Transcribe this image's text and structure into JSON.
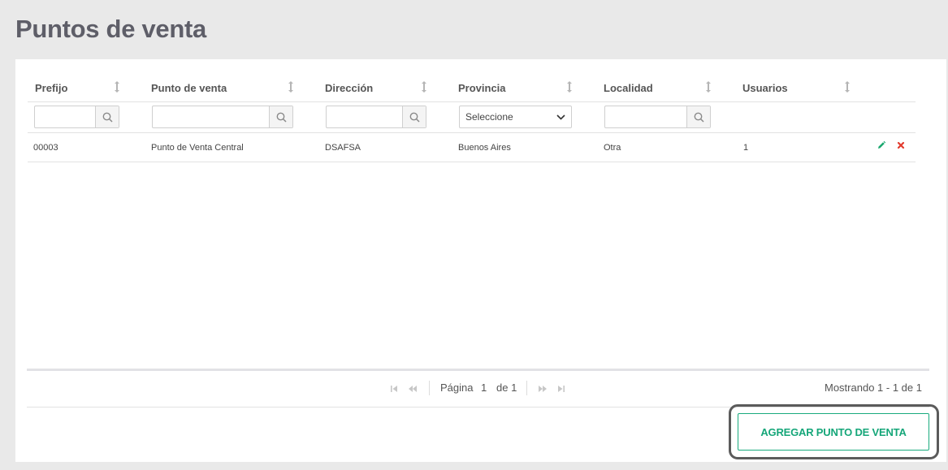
{
  "page": {
    "title": "Puntos de venta"
  },
  "table": {
    "columns": [
      "Prefijo",
      "Punto de venta",
      "Dirección",
      "Provincia",
      "Localidad",
      "Usuarios"
    ],
    "filters": {
      "prefijo_value": "",
      "punto_value": "",
      "direccion_value": "",
      "provincia_selected": "Seleccione",
      "localidad_value": ""
    },
    "rows": [
      {
        "prefijo": "00003",
        "punto": "Punto de Venta Central",
        "direccion": "DSAFSA",
        "provincia": "Buenos Aires",
        "localidad": "Otra",
        "usuarios": "1"
      }
    ]
  },
  "pagination": {
    "page_label": "Página",
    "current_page": "1",
    "of_label": "de 1",
    "showing": "Mostrando 1 - 1 de 1"
  },
  "actions": {
    "add_label": "AGREGAR PUNTO DE VENTA"
  },
  "colors": {
    "accent": "#15a679",
    "edit_icon": "#1aa86f",
    "delete_icon": "#e23b2e",
    "background": "#e9e9e9",
    "title": "#5e5e68"
  },
  "icons": [
    "sort-icon",
    "search-icon",
    "chevron-down-icon",
    "pencil-icon",
    "close-icon",
    "first-page-icon",
    "prev-page-icon",
    "next-page-icon",
    "last-page-icon"
  ]
}
